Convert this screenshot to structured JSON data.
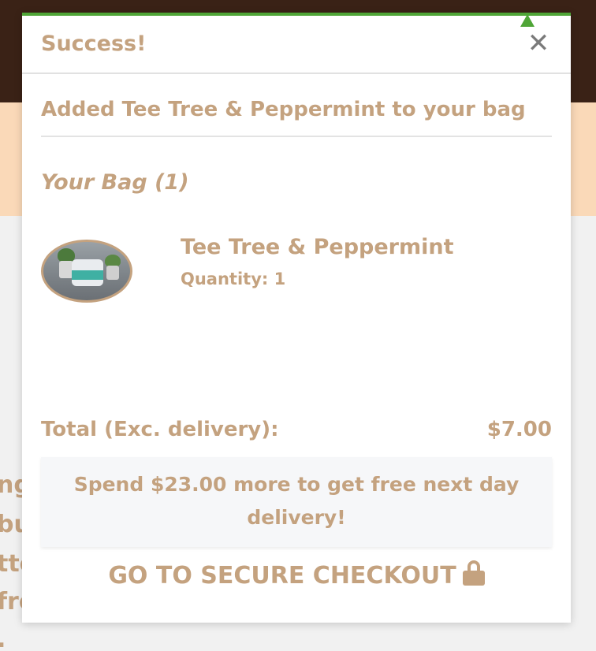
{
  "background": {
    "snippets": [
      "ng",
      "bu",
      "tte",
      "fre",
      "."
    ]
  },
  "modal": {
    "title": "Success!",
    "close_glyph": "✕",
    "added_message": "Added Tee Tree & Peppermint to your bag",
    "bag_heading": "Your Bag (1)",
    "item": {
      "name": "Tee Tree & Peppermint",
      "quantity": "Quantity: 1"
    },
    "total_label": "Total (Exc. delivery):",
    "total_value": "$7.00",
    "promo_message": "Spend $23.00 more to get free next day delivery!",
    "checkout_label": "GO TO SECURE CHECKOUT"
  },
  "colors": {
    "accent_green": "#4fa537",
    "text_tan": "#c4a27f",
    "header_brown": "#3a2216",
    "banner_peach": "#fad9b8"
  },
  "icons": {
    "close": "close-icon",
    "lock": "lock-icon"
  }
}
